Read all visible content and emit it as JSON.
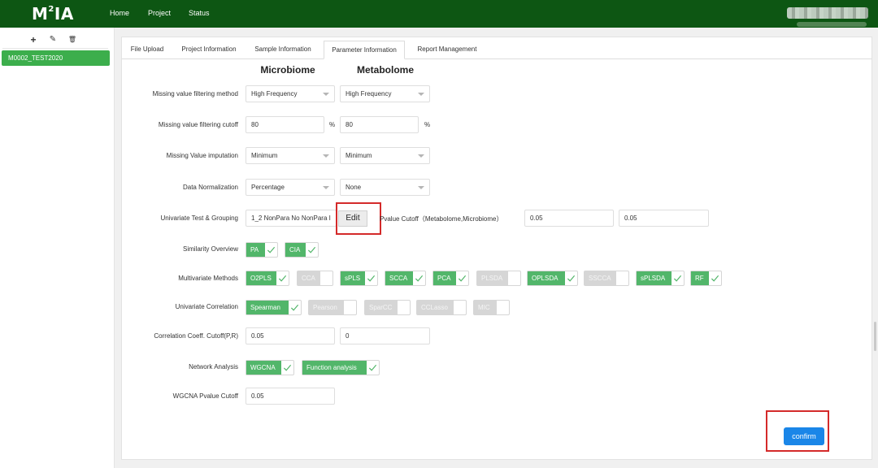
{
  "app": {
    "logo_main": "M",
    "logo_sup": "2",
    "logo_rest": "IA",
    "nav": [
      "Home",
      "Project",
      "Status"
    ]
  },
  "sidebar": {
    "tools": [
      "+",
      "✎",
      "🗑"
    ],
    "project": "M0002_TEST2020"
  },
  "tabs": [
    {
      "label": "File Upload"
    },
    {
      "label": "Project Information"
    },
    {
      "label": "Sample Information"
    },
    {
      "label": "Parameter Information"
    },
    {
      "label": "Report Management"
    }
  ],
  "columns": {
    "microbiome": "Microbiome",
    "metabolome": "Metabolome"
  },
  "form": {
    "missing_filter_method": {
      "label": "Missing value filtering method",
      "micro": "High Frequency",
      "meta": "High Frequency"
    },
    "missing_filter_cutoff": {
      "label": "Missing value filtering cutoff",
      "micro": "80",
      "meta": "80",
      "unit": "%"
    },
    "missing_imputation": {
      "label": "Missing Value imputation",
      "micro": "Minimum",
      "meta": "Minimum"
    },
    "normalization": {
      "label": "Data Normalization",
      "micro": "Percentage",
      "meta": "None"
    },
    "univariate_test": {
      "label": "Univariate Test & Grouping",
      "value": "1_2 NonPara No NonPara I",
      "edit": "Edit",
      "pvalue_label": "Pvalue Cutoff（Metabolome,Microbiome）",
      "pvalue_meta": "0.05",
      "pvalue_micro": "0.05"
    },
    "similarity": {
      "label": "Similarity Overview",
      "options": [
        {
          "name": "PA",
          "on": true
        },
        {
          "name": "CIA",
          "on": true
        }
      ]
    },
    "multivariate": {
      "label": "Multivariate Methods",
      "options": [
        {
          "name": "O2PLS",
          "on": true
        },
        {
          "name": "CCA",
          "on": false
        },
        {
          "name": "sPLS",
          "on": true
        },
        {
          "name": "SCCA",
          "on": true
        },
        {
          "name": "PCA",
          "on": true
        },
        {
          "name": "PLSDA",
          "on": false
        },
        {
          "name": "OPLSDA",
          "on": true
        },
        {
          "name": "SSCCA",
          "on": false
        },
        {
          "name": "sPLSDA",
          "on": true
        },
        {
          "name": "RF",
          "on": true
        }
      ]
    },
    "univariate_corr": {
      "label": "Univariate Correlation",
      "options": [
        {
          "name": "Spearman",
          "on": true
        },
        {
          "name": "Pearson",
          "on": false
        },
        {
          "name": "SparCC",
          "on": false
        },
        {
          "name": "CCLasso",
          "on": false
        },
        {
          "name": "MIC",
          "on": false
        }
      ]
    },
    "corr_cutoff": {
      "label": "Correlation Coeff. Cutoff(P,R)",
      "p": "0.05",
      "r": "0"
    },
    "network": {
      "label": "Network Analysis",
      "options": [
        {
          "name": "WGCNA",
          "on": true
        },
        {
          "name": "Function analysis",
          "on": true
        }
      ]
    },
    "wgcna_cutoff": {
      "label": "WGCNA Pvalue Cutoff",
      "value": "0.05"
    }
  },
  "confirm": "confirm",
  "colors": {
    "header": "#0d5613",
    "accent_green": "#52b66a",
    "confirm_blue": "#1a86e8",
    "highlight_red": "#d42a2a"
  }
}
